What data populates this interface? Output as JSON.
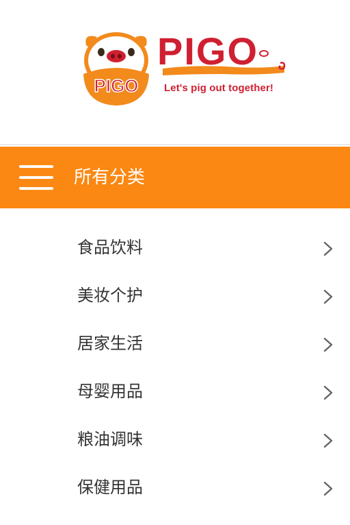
{
  "brand": {
    "mascot_text": "PIGO",
    "logo_text": "PIGO",
    "tagline": "Let's pig out together!",
    "colors": {
      "red": "#cf2031",
      "orange": "#fb8812"
    }
  },
  "category_bar": {
    "menu_icon": "hamburger-menu-icon",
    "title": "所有分类",
    "background": "#fb8812"
  },
  "categories": [
    {
      "label": "食品饮料",
      "icon": "chevron-right-icon"
    },
    {
      "label": "美妆个护",
      "icon": "chevron-right-icon"
    },
    {
      "label": "居家生活",
      "icon": "chevron-right-icon"
    },
    {
      "label": "母婴用品",
      "icon": "chevron-right-icon"
    },
    {
      "label": "粮油调味",
      "icon": "chevron-right-icon"
    },
    {
      "label": "保健用品",
      "icon": "chevron-right-icon"
    }
  ]
}
